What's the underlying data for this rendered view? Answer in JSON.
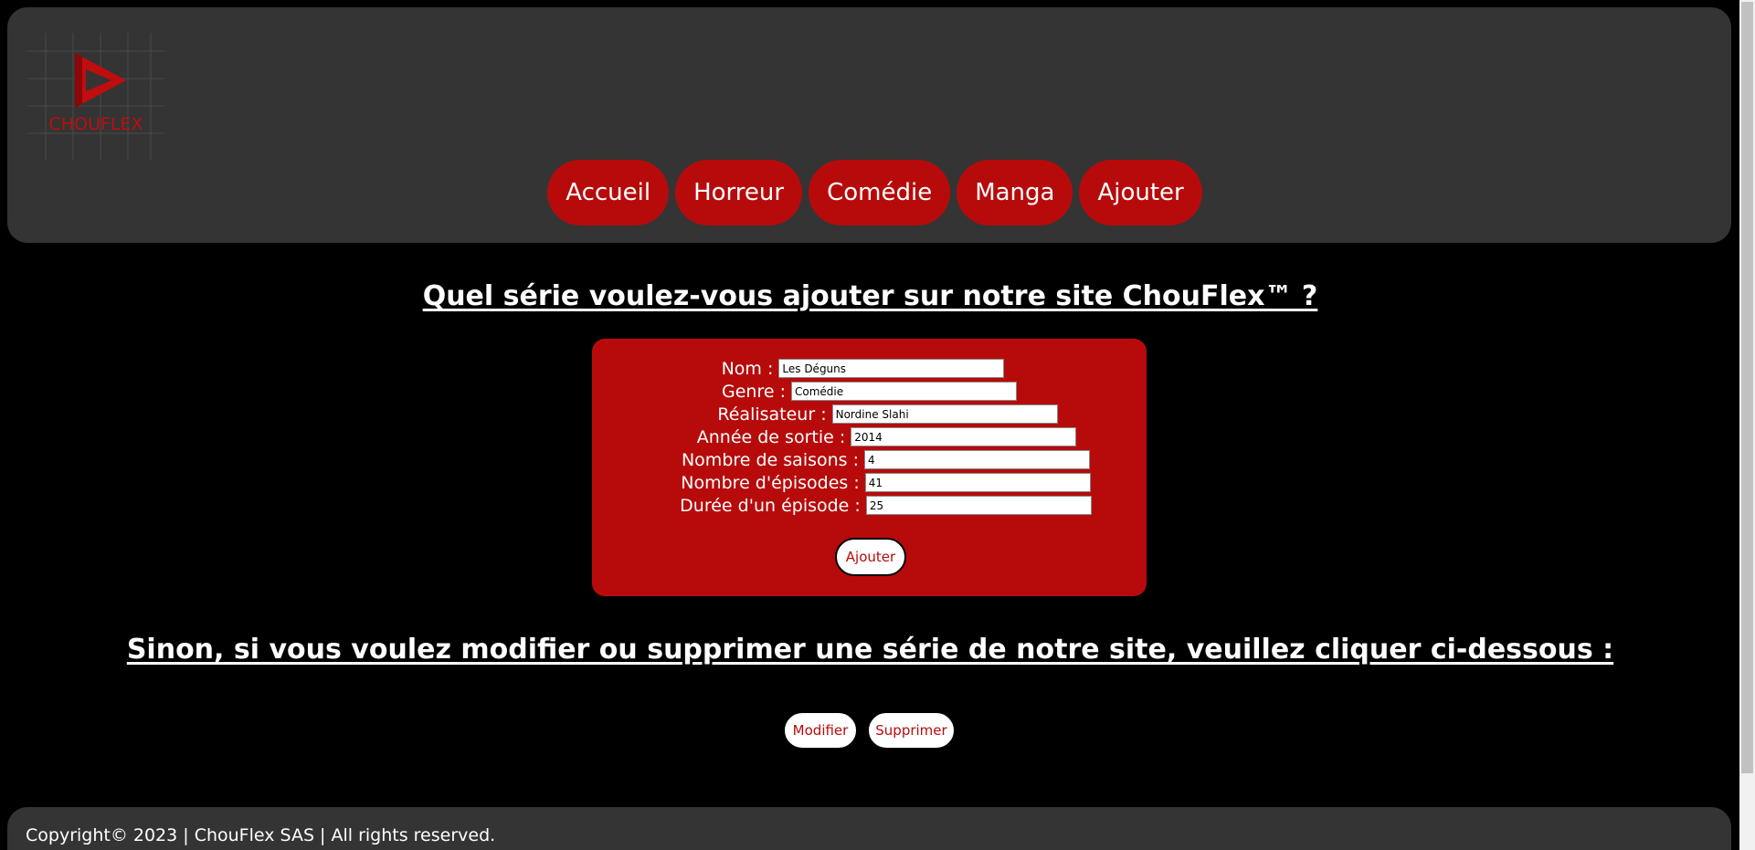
{
  "header": {
    "logo_text": "CHOUFLEX",
    "nav": [
      {
        "label": "Accueil"
      },
      {
        "label": "Horreur"
      },
      {
        "label": "Comédie"
      },
      {
        "label": "Manga"
      },
      {
        "label": "Ajouter"
      }
    ]
  },
  "add_section": {
    "title": "Quel série voulez-vous ajouter sur notre site ChouFlex™ ?",
    "fields": [
      {
        "label": "Nom :",
        "value": "Les Déguns"
      },
      {
        "label": "Genre :",
        "value": "Comédie"
      },
      {
        "label": "Réalisateur :",
        "value": "Nordine Slahi"
      },
      {
        "label": "Année de sortie :",
        "value": "2014"
      },
      {
        "label": "Nombre de saisons :",
        "value": "4"
      },
      {
        "label": "Nombre d'épisodes :",
        "value": "41"
      },
      {
        "label": "Durée d'un épisode :",
        "value": "25"
      }
    ],
    "submit_label": "Ajouter"
  },
  "modify_section": {
    "title": "Sinon, si vous voulez modifier ou supprimer une série de notre site, veuillez cliquer ci-dessous :",
    "modify_label": "Modifier",
    "delete_label": "Supprimer"
  },
  "footer": {
    "text": "Copyright© 2023  |  ChouFlex SAS  |  All rights reserved."
  },
  "colors": {
    "accent": "#b70b0b",
    "panel": "#343434",
    "background": "#000000"
  }
}
